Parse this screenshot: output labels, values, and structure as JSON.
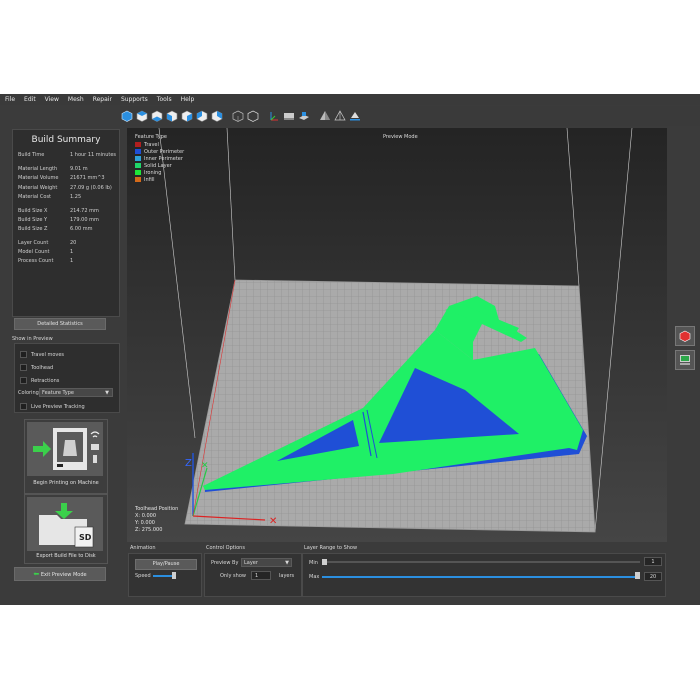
{
  "menu": [
    "File",
    "Edit",
    "View",
    "Mesh",
    "Repair",
    "Supports",
    "Tools",
    "Help"
  ],
  "toolbar_icons": [
    "view-iso-icon",
    "view-top-icon",
    "view-bottom-icon",
    "view-front-icon",
    "view-back-icon",
    "view-left-icon",
    "view-right-icon",
    "wireframe-icon",
    "solid-icon",
    "axes-icon",
    "bed-icon",
    "build-volume-icon",
    "shaded-icon",
    "xray-icon",
    "section-icon"
  ],
  "summary": {
    "title": "Build Summary",
    "rows": [
      {
        "label": "Build Time",
        "value": "1 hour 11 minutes"
      },
      {
        "label": "Material Length",
        "value": "9.01 m"
      },
      {
        "label": "Material Volume",
        "value": "21671 mm^3"
      },
      {
        "label": "Material Weight",
        "value": "27.09 g (0.06 lb)"
      },
      {
        "label": "Material Cost",
        "value": "1.25"
      },
      {
        "label": "Build Size X",
        "value": "214.72 mm"
      },
      {
        "label": "Build Size Y",
        "value": "179.00 mm"
      },
      {
        "label": "Build Size Z",
        "value": "6.00 mm"
      },
      {
        "label": "Layer Count",
        "value": "20"
      },
      {
        "label": "Model Count",
        "value": "1"
      },
      {
        "label": "Process Count",
        "value": "1"
      }
    ],
    "detail_button": "Detailed Statistics"
  },
  "show_in_preview": {
    "title": "Show in Preview",
    "travel": "Travel moves",
    "toolhead": "Toolhead",
    "retractions": "Retractions",
    "coloring_label": "Coloring",
    "coloring_value": "Feature Type",
    "live_tracking": "Live Preview Tracking"
  },
  "actions": {
    "begin_printing": "Begin Printing on Machine",
    "export": "Export Build File to Disk",
    "exit": "Exit Preview Mode",
    "sd_label": "SD"
  },
  "viewport": {
    "legend_title": "Feature Type",
    "legend": [
      {
        "name": "Travel",
        "color": "#b01f1f"
      },
      {
        "name": "Outer Perimeter",
        "color": "#1f4fd6"
      },
      {
        "name": "Inner Perimeter",
        "color": "#2ea3d9"
      },
      {
        "name": "Solid Layer",
        "color": "#1fd66a"
      },
      {
        "name": "Ironing",
        "color": "#1fe63a"
      },
      {
        "name": "Infill",
        "color": "#d46a1a"
      }
    ],
    "mode": "Preview Mode",
    "toolhead_title": "Toolhead Position",
    "x": "X: 0.000",
    "y": "Y: 0.000",
    "z": "Z: 275.000",
    "axis_z": "Z",
    "model_color": "#1ff066",
    "model_edge_color": "#1f4fd6"
  },
  "animation": {
    "title": "Animation",
    "play": "Play/Pause",
    "speed": "Speed"
  },
  "control": {
    "title": "Control Options",
    "preview_by_label": "Preview By",
    "preview_by_value": "Layer",
    "only_show": "Only show",
    "only_show_value": "1",
    "layers": "layers"
  },
  "range": {
    "title": "Layer Range to Show",
    "min_label": "Min",
    "min_value": "1",
    "max_label": "Max",
    "max_value": "20"
  }
}
